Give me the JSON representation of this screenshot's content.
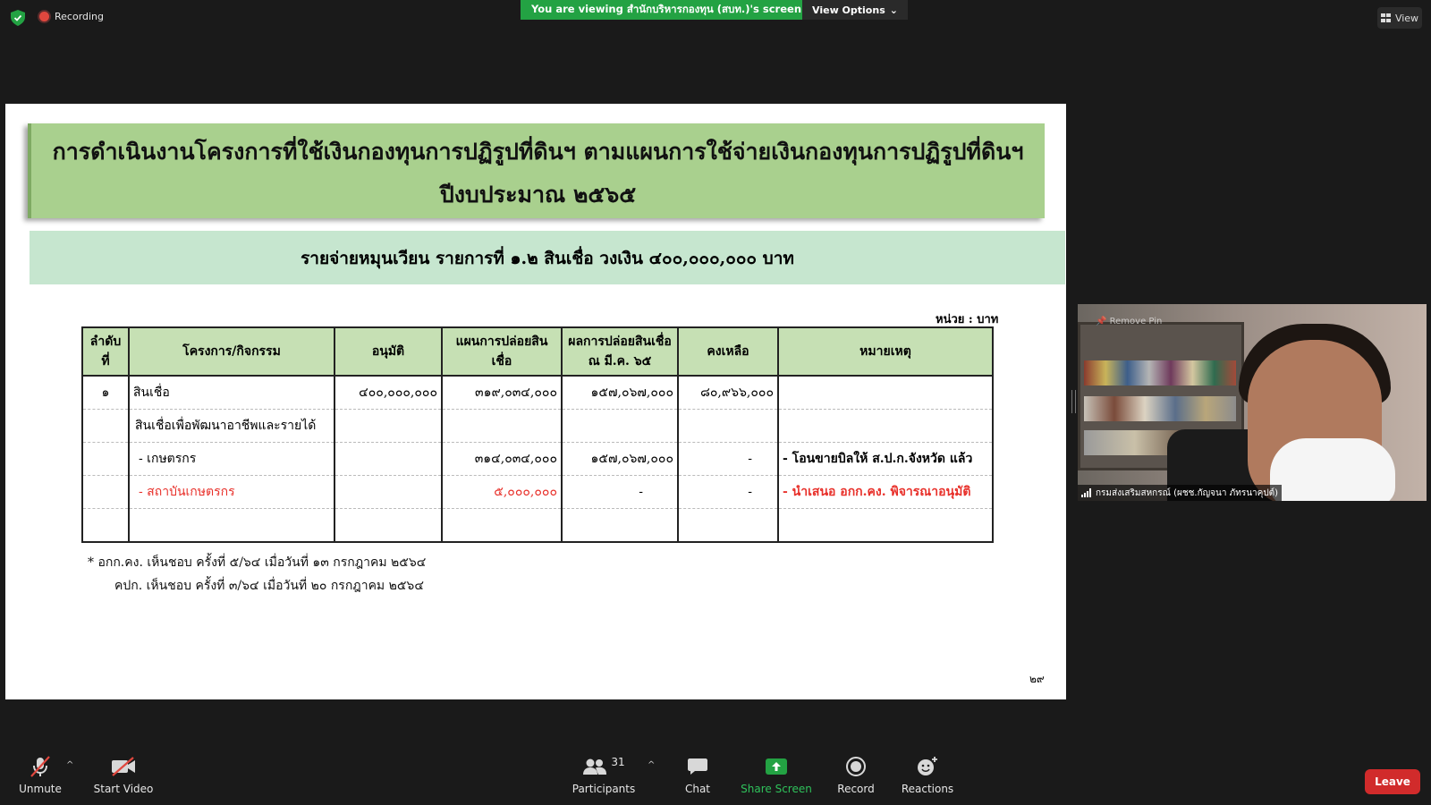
{
  "topbar": {
    "recording_label": "Recording",
    "viewing_banner": "You are viewing สำนักบริหารกองทุน (สบท.)'s screen",
    "view_options_label": "View Options",
    "view_label": "View"
  },
  "slide": {
    "title_line1": "การดำเนินงานโครงการที่ใช้เงินกองทุนการปฏิรูปที่ดินฯ ตามแผนการใช้จ่ายเงินกองทุนการปฏิรูปที่ดินฯ",
    "title_line2": "ปีงบประมาณ ๒๕๖๕",
    "subtitle": "รายจ่ายหมุนเวียน รายการที่ ๑.๒ สินเชื่อ วงเงิน ๔๐๐,๐๐๐,๐๐๐ บาท",
    "unit": "หน่วย : บาท",
    "table": {
      "headers": [
        "ลำดับที่",
        "โครงการ/กิจกรรม",
        "อนุมัติ",
        "แผนการปล่อยสินเชื่อ",
        "ผลการปล่อยสินเชื่อ ณ มี.ค. ๖๕",
        "คงเหลือ",
        "หมายเหตุ"
      ],
      "rows": [
        [
          "๑",
          "สินเชื่อ",
          "๔๐๐,๐๐๐,๐๐๐",
          "๓๑๙,๐๓๔,๐๐๐",
          "๑๕๗,๐๖๗,๐๐๐",
          "๘๐,๙๖๖,๐๐๐",
          ""
        ],
        [
          "",
          "สินเชื่อเพื่อพัฒนาอาชีพและรายได้",
          "",
          "",
          "",
          "",
          ""
        ],
        [
          "",
          "- เกษตรกร",
          "",
          "๓๑๔,๐๓๔,๐๐๐",
          "๑๕๗,๐๖๗,๐๐๐",
          "-",
          "- โอนขายบิลให้ ส.ป.ก.จังหวัด แล้ว"
        ],
        [
          "",
          "- สถาบันเกษตรกร",
          "",
          "๕,๐๐๐,๐๐๐",
          "-",
          "-",
          "- นำเสนอ อกก.คง. พิจารณาอนุมัติ"
        ],
        [
          "",
          "",
          "",
          "",
          "",
          "",
          ""
        ]
      ]
    },
    "note1": "* อกก.คง. เห็นชอบ ครั้งที่ ๕/๖๔ เมื่อวันที่ ๑๓ กรกฎาคม ๒๕๖๔",
    "note2": "คปก. เห็นชอบ ครั้งที่ ๓/๖๔ เมื่อวันที่ ๒๐ กรกฎาคม ๒๕๖๔",
    "page_number": "๒๙"
  },
  "video": {
    "remove_pin_label": "Remove Pin",
    "participant_name": "กรมส่งเสริมสหกรณ์ (ผชช.กัญจนา ภัทรนาคุปต์)"
  },
  "toolbar": {
    "unmute": "Unmute",
    "start_video": "Start Video",
    "participants": "Participants",
    "participants_count": "31",
    "chat": "Chat",
    "share_screen": "Share Screen",
    "record": "Record",
    "reactions": "Reactions",
    "leave": "Leave"
  },
  "colors": {
    "share_green": "#23a243",
    "leave_red": "#d12b2b",
    "title_green": "#a9d08e",
    "subtitle_green": "#c6e6cf",
    "table_header_green": "#c6e0b4",
    "note_red": "#e8302a"
  }
}
